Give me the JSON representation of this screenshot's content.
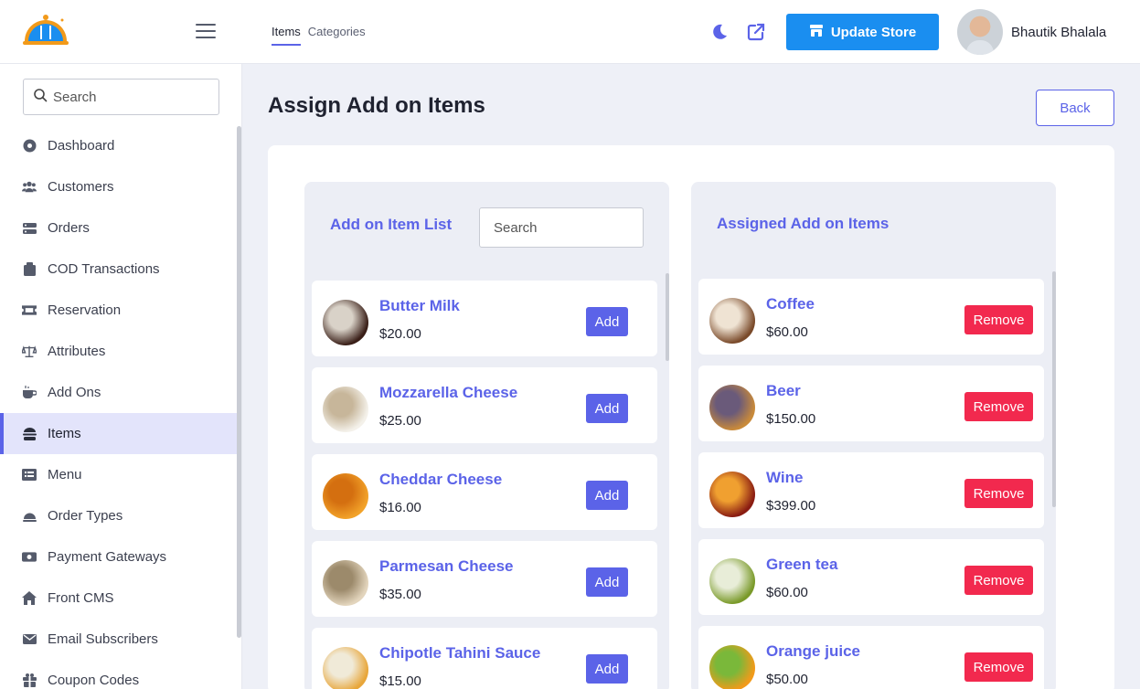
{
  "header": {
    "tabs": [
      {
        "label": "Items",
        "active": true
      },
      {
        "label": "Categories",
        "active": false
      }
    ],
    "update_store_label": "Update Store",
    "user_name": "Bhautik Bhalala",
    "brand_color": "#1a8ef0",
    "accent_color": "#5b63e8"
  },
  "sidebar": {
    "search_placeholder": "Search",
    "items": [
      {
        "label": "Dashboard",
        "icon": "dashboard-icon"
      },
      {
        "label": "Customers",
        "icon": "users-icon"
      },
      {
        "label": "Orders",
        "icon": "orders-icon"
      },
      {
        "label": "COD Transactions",
        "icon": "wallet-icon"
      },
      {
        "label": "Reservation",
        "icon": "ticket-icon"
      },
      {
        "label": "Attributes",
        "icon": "scale-icon"
      },
      {
        "label": "Add Ons",
        "icon": "cup-icon"
      },
      {
        "label": "Items",
        "icon": "burger-icon",
        "active": true
      },
      {
        "label": "Menu",
        "icon": "list-icon"
      },
      {
        "label": "Order Types",
        "icon": "cloche-icon"
      },
      {
        "label": "Payment Gateways",
        "icon": "money-icon"
      },
      {
        "label": "Front CMS",
        "icon": "home-icon"
      },
      {
        "label": "Email Subscribers",
        "icon": "mail-icon"
      },
      {
        "label": "Coupon Codes",
        "icon": "gift-icon"
      }
    ]
  },
  "main": {
    "title": "Assign Add on Items",
    "back_label": "Back",
    "available": {
      "title": "Add on Item List",
      "search_placeholder": "Search",
      "button_label": "Add",
      "items": [
        {
          "name": "Butter Milk",
          "price": "$20.00",
          "colors": [
            "#3a1f18",
            "#d9d2c8"
          ]
        },
        {
          "name": "Mozzarella Cheese",
          "price": "$25.00",
          "colors": [
            "#f4f1ea",
            "#c7b69a"
          ]
        },
        {
          "name": "Cheddar Cheese",
          "price": "$16.00",
          "colors": [
            "#f2a229",
            "#d46f10"
          ]
        },
        {
          "name": "Parmesan Cheese",
          "price": "$35.00",
          "colors": [
            "#e3d5bd",
            "#9c8a6b"
          ]
        },
        {
          "name": "Chipotle Tahini Sauce",
          "price": "$15.00",
          "colors": [
            "#e8a63a",
            "#f0ead8"
          ]
        }
      ]
    },
    "assigned": {
      "title": "Assigned Add on Items",
      "button_label": "Remove",
      "items": [
        {
          "name": "Coffee",
          "price": "$60.00",
          "colors": [
            "#7a4a2a",
            "#efe3d3"
          ]
        },
        {
          "name": "Beer",
          "price": "$150.00",
          "colors": [
            "#c98a3a",
            "#6a5a7a"
          ]
        },
        {
          "name": "Wine",
          "price": "$399.00",
          "colors": [
            "#8a1c12",
            "#f0a030"
          ]
        },
        {
          "name": "Green tea",
          "price": "$60.00",
          "colors": [
            "#7a9a2a",
            "#e8edd8"
          ]
        },
        {
          "name": "Orange juice",
          "price": "$50.00",
          "colors": [
            "#f29a1a",
            "#7ab83a"
          ]
        }
      ]
    }
  }
}
